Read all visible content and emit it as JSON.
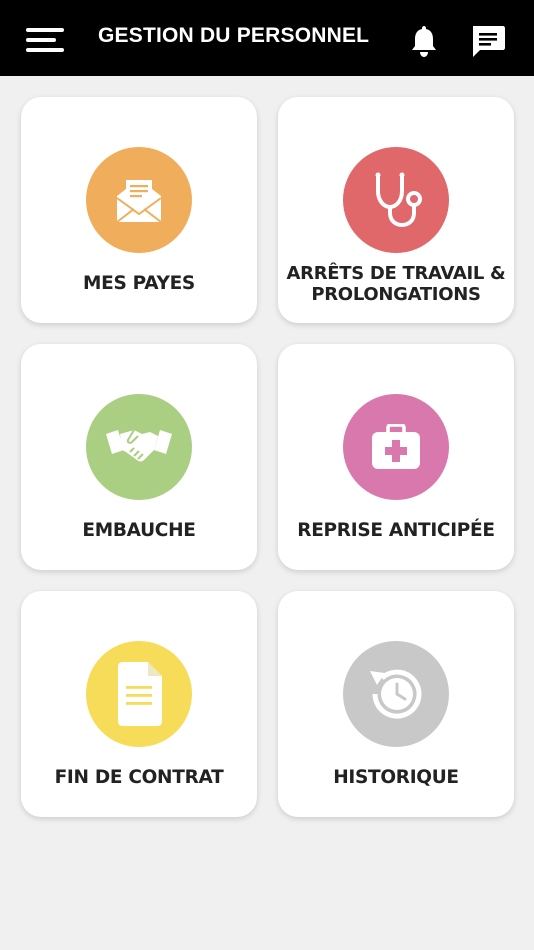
{
  "header": {
    "title": "GESTION DU PERSONNEL"
  },
  "tiles": [
    {
      "label": "MES PAYES",
      "icon": "envelope-icon",
      "color": "#f0ae5c"
    },
    {
      "label_line1": "ARRÊTS DE TRAVAIL &",
      "label_line2": "PROLONGATIONS",
      "icon": "stethoscope-icon",
      "color": "#e0676a"
    },
    {
      "label": "EMBAUCHE",
      "icon": "handshake-icon",
      "color": "#aacf82"
    },
    {
      "label": "REPRISE ANTICIPÉE",
      "icon": "medical-kit-icon",
      "color": "#d978ad"
    },
    {
      "label": "FIN DE CONTRAT",
      "icon": "document-icon",
      "color": "#f7dc5a"
    },
    {
      "label": "HISTORIQUE",
      "icon": "history-clock-icon",
      "color": "#c8c8c8"
    }
  ]
}
